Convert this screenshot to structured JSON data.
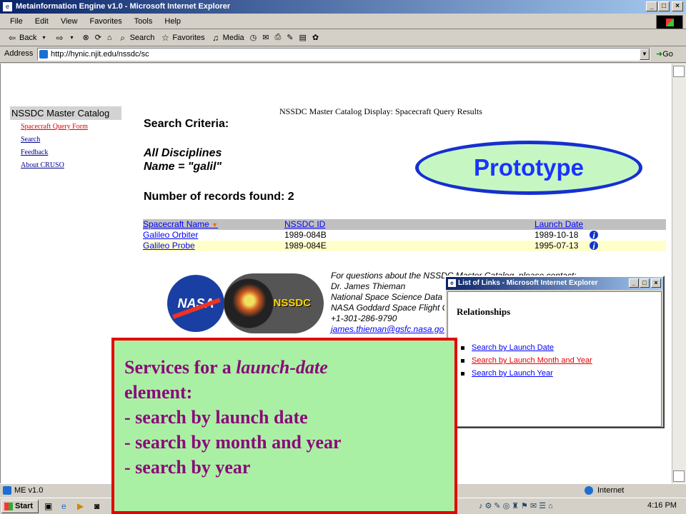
{
  "window": {
    "title": "Metainformation Engine v1.0 - Microsoft Internet Explorer",
    "min": "_",
    "max": "□",
    "close": "×"
  },
  "menu": [
    "File",
    "Edit",
    "View",
    "Favorites",
    "Tools",
    "Help"
  ],
  "toolbar": {
    "back": "Back",
    "search": "Search",
    "favorites": "Favorites",
    "media": "Media"
  },
  "address": {
    "label": "Address",
    "url": "http://hynic.njit.edu/nssdc/sc",
    "go": "Go"
  },
  "sidebar": {
    "title": "NSSDC Master Catalog",
    "links": [
      "Spacecraft Query Form",
      "Search",
      "Feedback",
      "About CRUSO"
    ]
  },
  "page": {
    "header": "NSSDC Master Catalog Display: Spacecraft Query Results",
    "criteria_heading": "Search Criteria:",
    "criteria_line1": "All Disciplines",
    "criteria_line2": "Name = \"galil\"",
    "records": "Number of records found: 2"
  },
  "table": {
    "headers": {
      "name": "Spacecraft Name",
      "id": "NSSDC ID",
      "date": "Launch Date"
    },
    "rows": [
      {
        "name": "Galileo Orbiter",
        "id": "1989-084B",
        "date": "1989-10-18"
      },
      {
        "name": "Galileo Probe",
        "id": "1989-084E",
        "date": "1995-07-13"
      }
    ]
  },
  "logo": {
    "nasa": "NASA",
    "nssdc": "NSSDC"
  },
  "contact": [
    "For questions about the NSSDC Master Catalog, please contact:",
    "Dr. James Thieman",
    "National Space Science Data Center",
    "NASA Goddard Space Flight Center",
    "+1-301-286-9790",
    "james.thieman@gsfc.nasa.gov"
  ],
  "prototype_label": "Prototype",
  "popup": {
    "title": "List of Links - Microsoft Internet Explorer",
    "heading": "Relationships",
    "links": [
      "Search by Launch Date",
      "Search by Launch Month and Year",
      "Search by Launch Year"
    ]
  },
  "callout": {
    "line1_prefix": "Services for a ",
    "line1_emph": "launch-date",
    "line2": "element:",
    "line3": "- search by launch date",
    "line4": "- search by month and year",
    "line5": "- search by year"
  },
  "status": {
    "left": "ME v1.0",
    "zone": "Internet"
  },
  "taskbar": {
    "start": "Start",
    "time": "4:16 PM"
  },
  "colors": {
    "visited_link": "#e00000",
    "link": "#0000ff",
    "callout_text": "#8a0a7a"
  }
}
